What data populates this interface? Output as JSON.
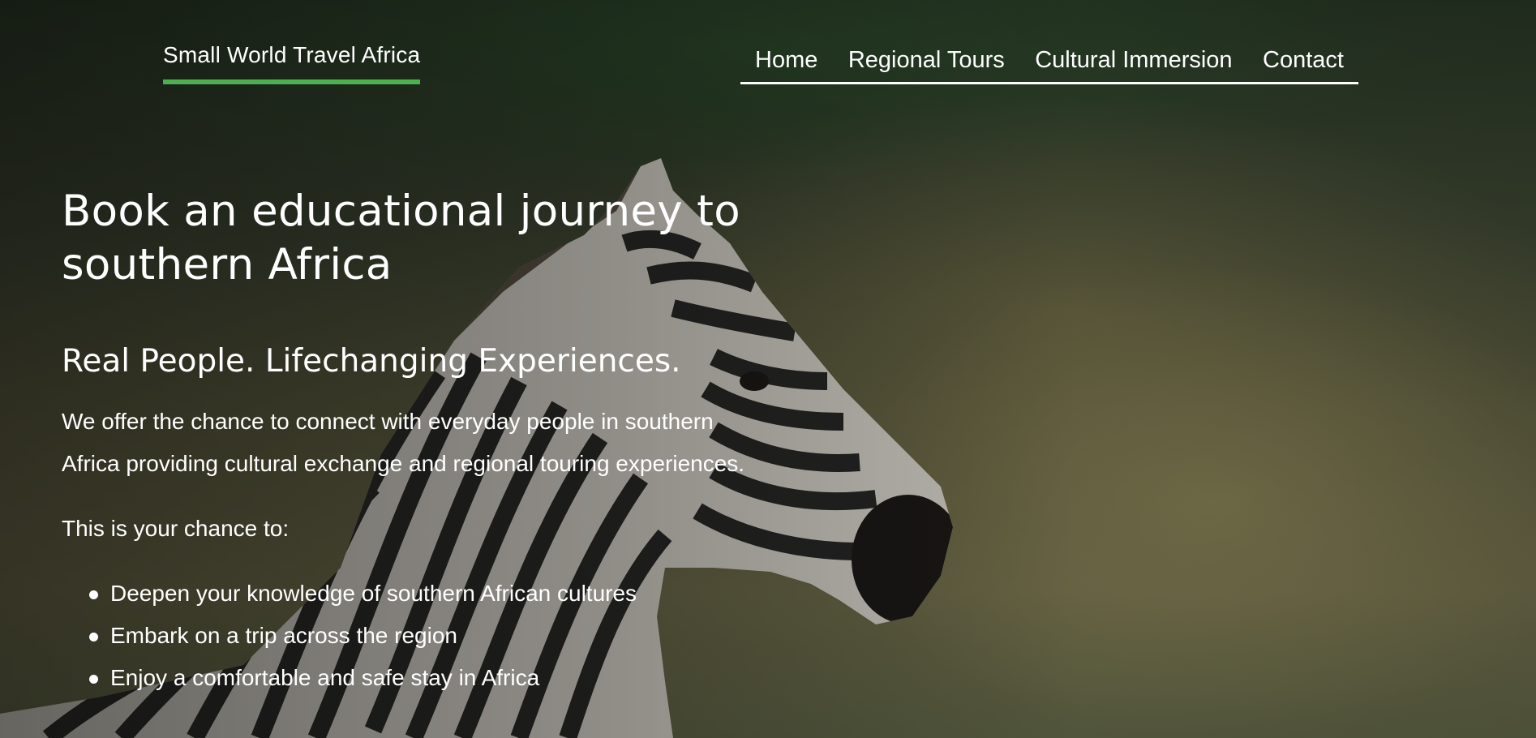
{
  "brand": {
    "name": "Small World Travel Africa",
    "underline_color": "#4caf50"
  },
  "nav": {
    "items": [
      {
        "label": "Home"
      },
      {
        "label": "Regional Tours"
      },
      {
        "label": "Cultural Immersion"
      },
      {
        "label": "Contact"
      }
    ]
  },
  "hero": {
    "title": "Book an educational journey to southern Africa",
    "subtitle": "Real People. Lifechanging Experiences.",
    "intro": "We offer the chance to connect with everyday people in southern Africa providing cultural exchange and regional touring experiences.",
    "lead": "This is your chance to:",
    "bullets": [
      "Deepen your knowledge of southern African cultures",
      "Embark on a trip across the region",
      "Enjoy a comfortable and safe stay in Africa"
    ]
  }
}
